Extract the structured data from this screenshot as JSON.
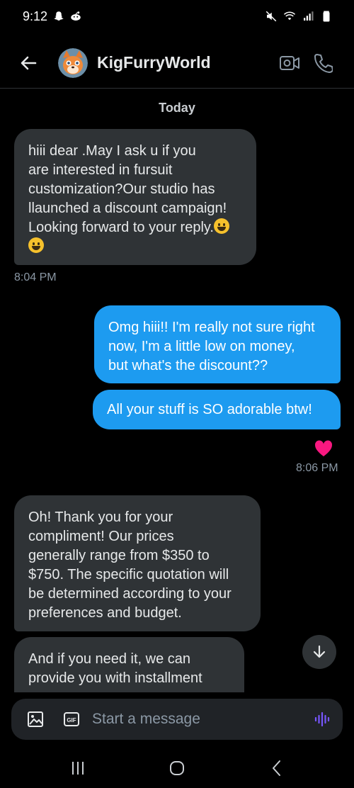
{
  "status_bar": {
    "time": "9:12"
  },
  "header": {
    "name": "KigFurryWorld"
  },
  "date_separator": "Today",
  "messages": [
    {
      "direction": "in",
      "text": "hiii dear .May I ask u if you\nare interested in fursuit\ncustomization?Our studio has\nllaunched a discount campaign!\nLooking forward to your reply.",
      "time": "8:04 PM"
    },
    {
      "direction": "out",
      "text": "Omg hiii!! I'm really not sure right\nnow, I'm a little low on money,\nbut what's the discount??"
    },
    {
      "direction": "out",
      "text": "All your stuff is SO adorable btw!",
      "reaction": "heart",
      "time": "8:06 PM"
    },
    {
      "direction": "in",
      "text": "Oh! Thank you for your\ncompliment! Our prices\ngenerally range from $350 to\n$750. The specific quotation will\nbe determined according to your\npreferences and budget."
    },
    {
      "direction": "in",
      "text": "And if you need it, we can\nprovide you with installment"
    }
  ],
  "composer": {
    "placeholder": "Start a message",
    "gif_label": "GIF"
  },
  "colors": {
    "background": "#000000",
    "incoming_bubble": "#2f3336",
    "outgoing_bubble": "#1d9bf0",
    "heart": "#f91880",
    "voice_icon": "#7856ff"
  }
}
